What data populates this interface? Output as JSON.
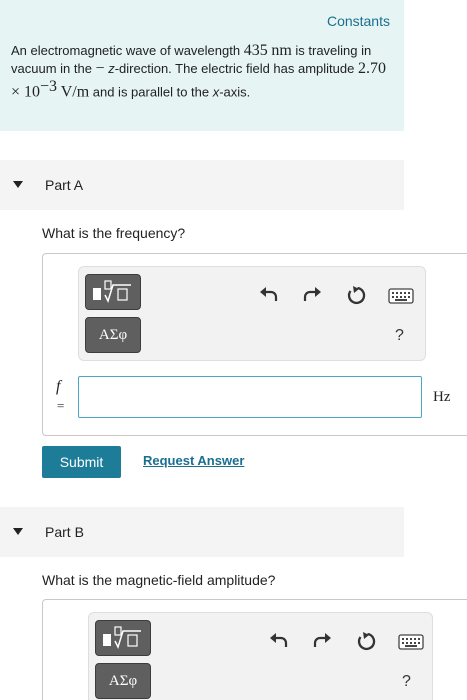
{
  "problem": {
    "constants_link": "Constants",
    "t1": "An electromagnetic wave of wavelength ",
    "wavelength": "435",
    "nm": "nm",
    "t2": " is traveling in vacuum in the ",
    "minus": "−",
    "zdir": "z",
    "t3": "-direction. The electric field has amplitude ",
    "amp_mantissa": "2.70 × 10",
    "amp_exp": "−3",
    "amp_unit": "V/m",
    "t4": " and is parallel to the ",
    "xaxis": "x",
    "t5": "-axis."
  },
  "partA": {
    "title": "Part A",
    "question": "What is the frequency?",
    "greek_label": "ΑΣφ",
    "help_label": "?",
    "variable": "f",
    "equals": "=",
    "input_value": "",
    "unit": "Hz",
    "submit_label": "Submit",
    "request_label": "Request Answer"
  },
  "partB": {
    "title": "Part B",
    "question": "What is the magnetic-field amplitude?",
    "greek_label": "ΑΣφ",
    "help_label": "?"
  },
  "colors": {
    "problem_bg": "#e6f4f4",
    "link": "#1a6f8f",
    "submit_bg": "#1d7c98",
    "toolbar_button": "#5f5f5f"
  }
}
